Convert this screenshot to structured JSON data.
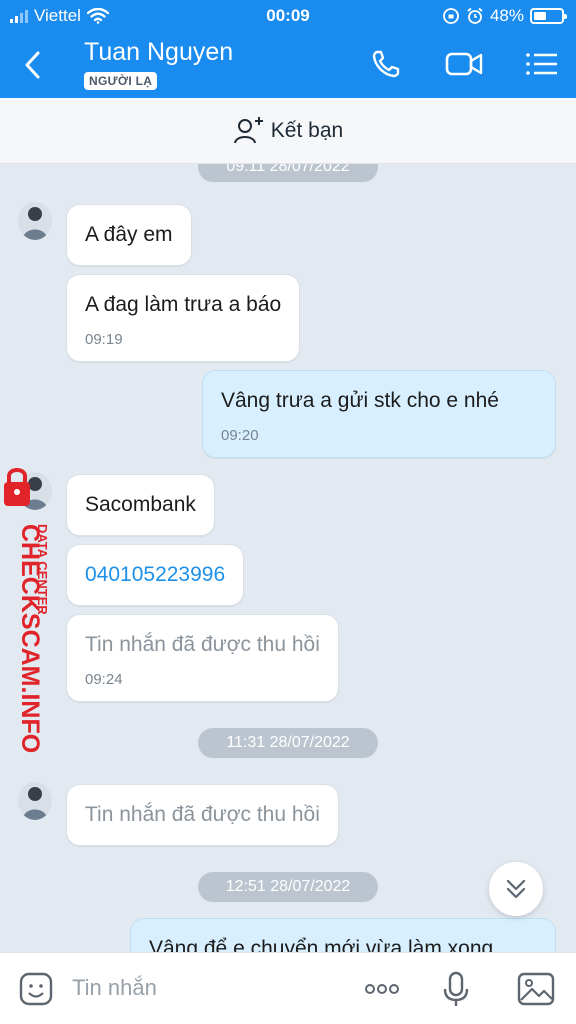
{
  "status_bar": {
    "carrier": "Viettel",
    "time": "00:09",
    "battery": "48%",
    "battery_level": 0.48
  },
  "header": {
    "title": "Tuan Nguyen",
    "badge": "NGƯỜI LẠ"
  },
  "add_friend": {
    "label": "Kết bạn"
  },
  "chat": {
    "top_timestamp": "09:11 28/07/2022",
    "messages": [
      {
        "text": "A đây em"
      },
      {
        "text": "A đag làm trưa a báo",
        "time": "09:19"
      },
      {
        "text": "Vâng trưa a gửi stk cho e nhé",
        "time": "09:20"
      },
      {
        "text": "Sacombank"
      },
      {
        "text": "040105223996"
      },
      {
        "text": "Tin nhắn đã được thu hồi",
        "time": "09:24"
      },
      {
        "text": "Tin nhắn đã được thu hồi"
      },
      {
        "text": "Vâng để e chuyển mới vừa làm xong"
      }
    ],
    "timestamps": [
      "11:31 28/07/2022",
      "12:51 28/07/2022"
    ]
  },
  "watermark": {
    "line1": "DATA CENTER",
    "line2": "CHECKSCAM.INFO"
  },
  "input": {
    "placeholder": "Tin nhắn"
  },
  "colors": {
    "header": "#1a8cf0",
    "outgoing_bubble": "#d7efff",
    "link": "#1d90e8",
    "watermark": "#e0242a"
  }
}
